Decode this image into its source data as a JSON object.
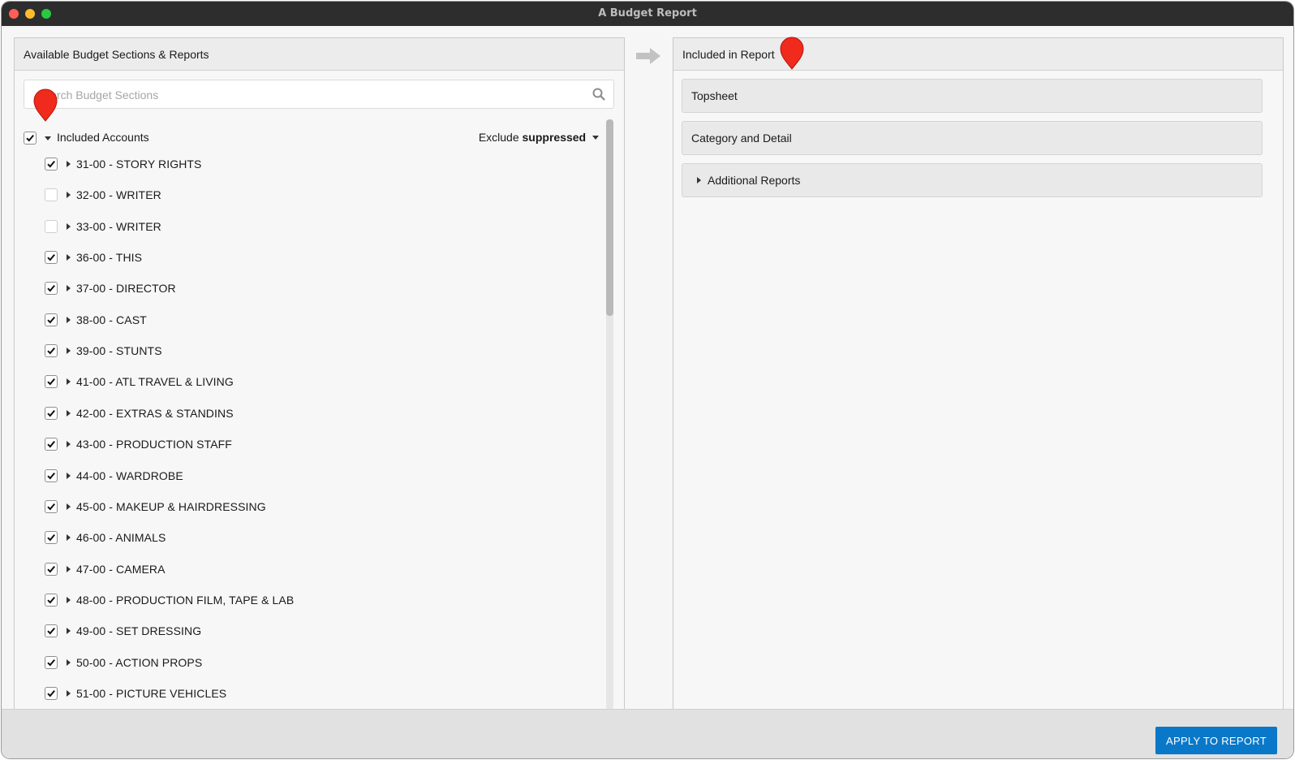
{
  "window": {
    "title": "A Budget Report"
  },
  "left_panel": {
    "title": "Available Budget Sections & Reports",
    "search_placeholder": "Search Budget Sections",
    "group": {
      "label": "Included Accounts",
      "checked": true,
      "filter_prefix": "Exclude",
      "filter_value": "suppressed"
    },
    "accounts": [
      {
        "label": "31-00 - STORY RIGHTS",
        "checked": true
      },
      {
        "label": "32-00 - WRITER",
        "checked": false
      },
      {
        "label": "33-00 - WRITER",
        "checked": false
      },
      {
        "label": "36-00 - THIS",
        "checked": true
      },
      {
        "label": "37-00 - DIRECTOR",
        "checked": true
      },
      {
        "label": "38-00 - CAST",
        "checked": true
      },
      {
        "label": "39-00 - STUNTS",
        "checked": true
      },
      {
        "label": "41-00 - ATL TRAVEL & LIVING",
        "checked": true
      },
      {
        "label": "42-00 - EXTRAS & STANDINS",
        "checked": true
      },
      {
        "label": "43-00 - PRODUCTION STAFF",
        "checked": true
      },
      {
        "label": "44-00 - WARDROBE",
        "checked": true
      },
      {
        "label": "45-00 - MAKEUP & HAIRDRESSING",
        "checked": true
      },
      {
        "label": "46-00 - ANIMALS",
        "checked": true
      },
      {
        "label": "47-00 - CAMERA",
        "checked": true
      },
      {
        "label": "48-00 - PRODUCTION FILM, TAPE & LAB",
        "checked": true
      },
      {
        "label": "49-00 - SET DRESSING",
        "checked": true
      },
      {
        "label": "50-00 - ACTION PROPS",
        "checked": true
      },
      {
        "label": "51-00 - PICTURE VEHICLES",
        "checked": true
      }
    ]
  },
  "right_panel": {
    "title": "Included in Report",
    "items": [
      {
        "label": "Topsheet"
      },
      {
        "label": "Category and Detail"
      },
      {
        "label": "Additional Reports"
      }
    ]
  },
  "footer": {
    "apply_label": "APPLY TO REPORT"
  },
  "colors": {
    "accent": "#0a78c8",
    "marker": "#f02a1c",
    "titlebar": "#2d2d2d"
  }
}
